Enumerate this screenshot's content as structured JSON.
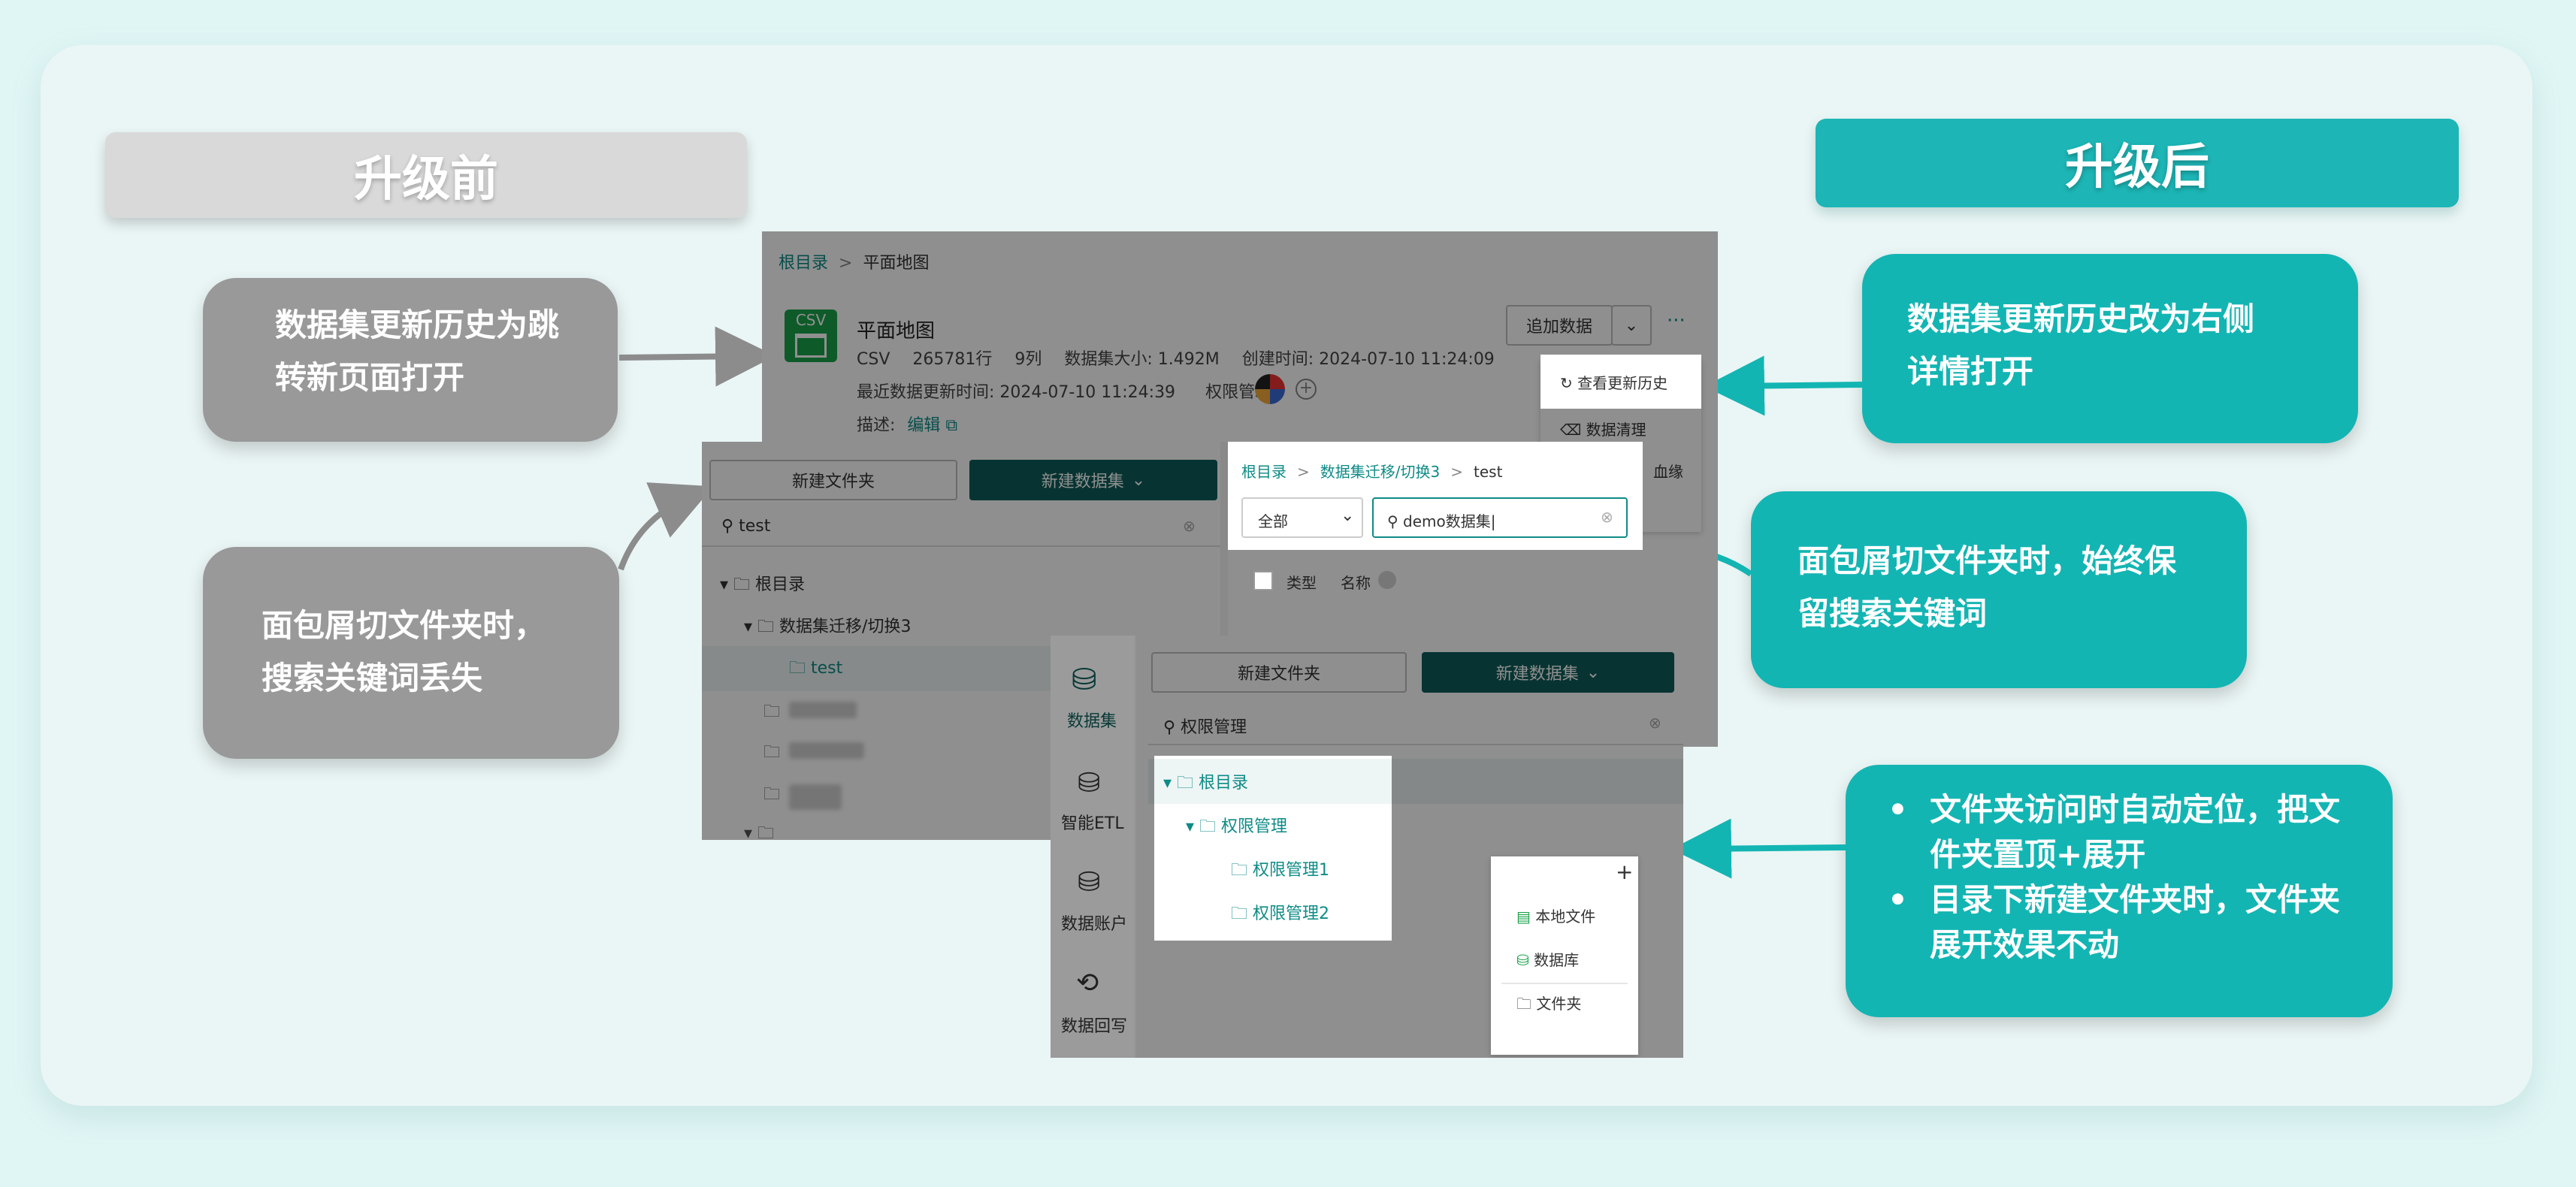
{
  "banners": {
    "before": "升级前",
    "after": "升级后"
  },
  "callouts": {
    "before_history": [
      "数据集更新历史为跳",
      "转新页面打开"
    ],
    "before_breadcrumb": [
      "面包屑切文件夹时，",
      "搜索关键词丢失"
    ],
    "after_history": [
      "数据集更新历史改为右侧",
      "详情打开"
    ],
    "after_breadcrumb": [
      "面包屑切文件夹时，始终保",
      "留搜索关键词"
    ],
    "after_folder": [
      "文件夹访问时自动定位，把文件夹置顶+展开",
      "目录下新建文件夹时，文件夹展开效果不动"
    ]
  },
  "dataset_detail": {
    "breadcrumb_root": "根目录",
    "breadcrumb_sep": ">",
    "breadcrumb_current": "平面地图",
    "file_badge": "CSV",
    "name": "平面地图",
    "format": "CSV",
    "rows": "265781行",
    "cols": "9列",
    "size": "数据集大小: 1.492M",
    "created": "创建时间: 2024-07-10 11:24:09",
    "updated": "最近数据更新时间: 2024-07-10 11:24:39",
    "permission_label": "权限管理:",
    "desc_label": "描述:",
    "edit_label": "编辑",
    "add_data": "追加数据",
    "more": "···",
    "menu": [
      "查看更新历史",
      "数据清理",
      "血缘"
    ]
  },
  "before_tree": {
    "new_folder": "新建文件夹",
    "new_dataset": "新建数据集",
    "search_value": "test",
    "items": [
      "根目录",
      "数据集迁移/切换3",
      "test"
    ]
  },
  "after_search": {
    "breadcrumb_root": "根目录",
    "breadcrumb_mid": "数据集迁移/切换3",
    "breadcrumb_current": "test",
    "sep": ">",
    "filter_value": "全部",
    "search_value": "demo数据集",
    "col_type": "类型",
    "col_name": "名称"
  },
  "after_tree": {
    "nav": [
      "数据集",
      "智能ETL",
      "数据账户",
      "数据回写"
    ],
    "new_folder": "新建文件夹",
    "new_dataset": "新建数据集",
    "search_value": "权限管理",
    "items": [
      "根目录",
      "权限管理",
      "权限管理1",
      "权限管理2"
    ],
    "plus": "+",
    "add_menu": [
      "本地文件",
      "数据库",
      "文件夹"
    ]
  }
}
